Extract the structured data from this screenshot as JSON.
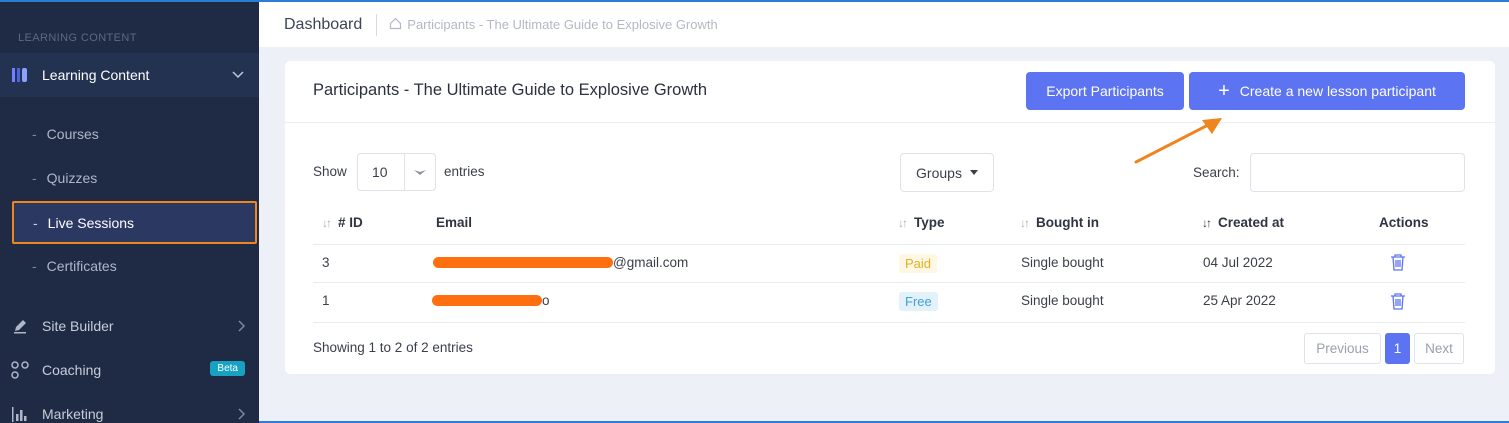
{
  "sidebar": {
    "section_label": "LEARNING CONTENT",
    "parent": {
      "label": "Learning Content",
      "icon": "book-icon"
    },
    "sub_items": [
      {
        "label": "Courses"
      },
      {
        "label": "Quizzes"
      },
      {
        "label": "Live Sessions",
        "active": true
      },
      {
        "label": "Certificates"
      }
    ],
    "items": [
      {
        "label": "Site Builder",
        "icon": "pencil-icon"
      },
      {
        "label": "Coaching",
        "icon": "nodes-icon",
        "badge": "Beta"
      },
      {
        "label": "Marketing",
        "icon": "bar-chart-icon"
      }
    ]
  },
  "topbar": {
    "title": "Dashboard",
    "breadcrumb": "Participants - The Ultimate Guide to Explosive Growth"
  },
  "card": {
    "title": "Participants - The Ultimate Guide to Explosive Growth",
    "export_label": "Export Participants",
    "create_label": "Create a new lesson participant"
  },
  "controls": {
    "show_label": "Show",
    "page_size": "10",
    "entries_label": "entries",
    "groups_label": "Groups",
    "search_label": "Search:",
    "search_value": ""
  },
  "table": {
    "columns": [
      "# ID",
      "Email",
      "Type",
      "Bought in",
      "Created at",
      "Actions"
    ],
    "rows": [
      {
        "id": "3",
        "email": "@gmail.com",
        "type": "Paid",
        "bought_in": "Single bought",
        "created_at": "04 Jul 2022"
      },
      {
        "id": "1",
        "email": "o",
        "type": "Free",
        "bought_in": "Single bought",
        "created_at": "25 Apr 2022"
      }
    ]
  },
  "footer": {
    "info": "Showing 1 to 2 of 2 entries",
    "prev": "Previous",
    "page": "1",
    "next": "Next"
  },
  "colors": {
    "accent": "#5c73f2",
    "sidebar_bg": "#1f2b44",
    "highlight": "#f0841e",
    "paid": "#e5b122",
    "free": "#3ea0dd",
    "beta": "#17a2c4"
  }
}
